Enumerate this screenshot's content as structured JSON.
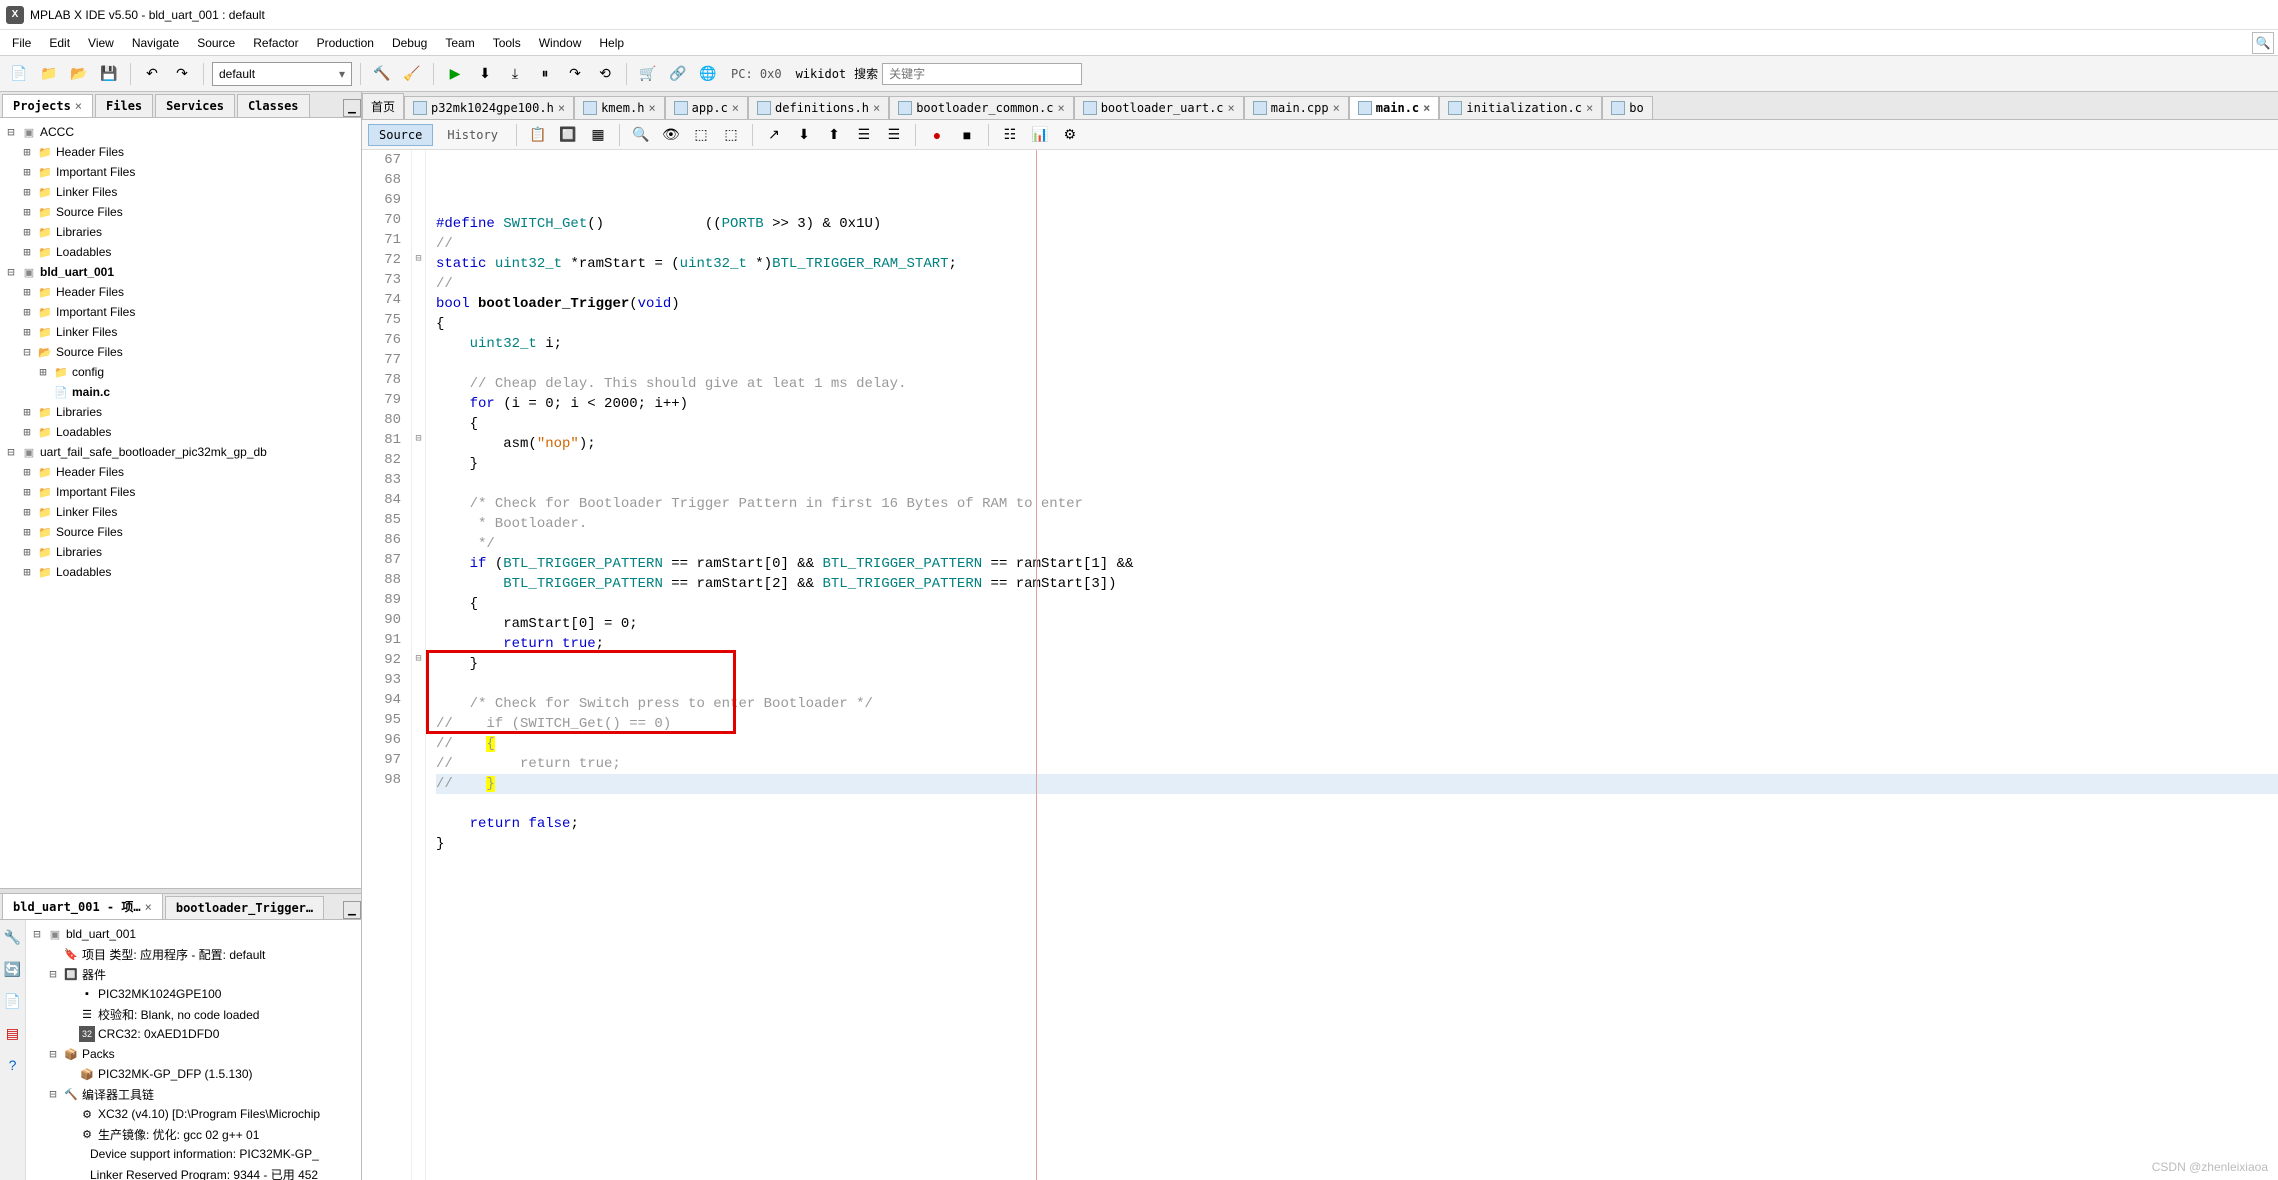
{
  "title": "MPLAB X IDE v5.50 - bld_uart_001 : default",
  "menubar": [
    "File",
    "Edit",
    "View",
    "Navigate",
    "Source",
    "Refactor",
    "Production",
    "Debug",
    "Team",
    "Tools",
    "Window",
    "Help"
  ],
  "toolbar": {
    "config_combo": "default",
    "pc_label": "PC: 0x0",
    "wikidot": "wikidot",
    "search_label": "搜索",
    "search_placeholder": "关键字"
  },
  "left_tabs": {
    "projects": "Projects",
    "files": "Files",
    "services": "Services",
    "classes": "Classes"
  },
  "projects": [
    {
      "name": "ACCC",
      "bold": false,
      "children": [
        "Header Files",
        "Important Files",
        "Linker Files",
        "Source Files",
        "Libraries",
        "Loadables"
      ]
    },
    {
      "name": "bld_uart_001",
      "bold": true,
      "children": [
        "Header Files",
        "Important Files",
        "Linker Files"
      ],
      "source_files": {
        "label": "Source Files",
        "children": [
          {
            "name": "config",
            "type": "folder"
          },
          {
            "name": "main.c",
            "type": "file",
            "selected": true
          }
        ]
      },
      "tail": [
        "Libraries",
        "Loadables"
      ]
    },
    {
      "name": "uart_fail_safe_bootloader_pic32mk_gp_db",
      "bold": false,
      "children": [
        "Header Files",
        "Important Files",
        "Linker Files",
        "Source Files",
        "Libraries",
        "Loadables"
      ]
    }
  ],
  "lower_tabs": {
    "dashboard": "bld_uart_001 - 项…",
    "nav": "bootloader_Trigger…"
  },
  "dashboard": {
    "proj": "bld_uart_001",
    "proj_type": "项目 类型: 应用程序 - 配置: default",
    "device_hdr": "器件",
    "device": "PIC32MK1024GPE100",
    "checksum": "校验和: Blank, no code loaded",
    "crc32": "CRC32: 0xAED1DFD0",
    "packs_hdr": "Packs",
    "pack": "PIC32MK-GP_DFP (1.5.130)",
    "toolchain_hdr": "编译器工具链",
    "xc32": "XC32 (v4.10) [D:\\Program Files\\Microchip",
    "prod_image": "生产镜像: 优化: gcc 02 g++ 01",
    "dev_support": "Device support information: PIC32MK-GP_",
    "linker_res": "Linker Reserved Program: 9344 - 已用 452"
  },
  "editor_tabs": [
    {
      "label": "首页",
      "icon": false,
      "closable": false
    },
    {
      "label": "p32mk1024gpe100.h",
      "icon": true,
      "closable": true
    },
    {
      "label": "kmem.h",
      "icon": true,
      "closable": true
    },
    {
      "label": "app.c",
      "icon": true,
      "closable": true
    },
    {
      "label": "definitions.h",
      "icon": true,
      "closable": true
    },
    {
      "label": "bootloader_common.c",
      "icon": true,
      "closable": true
    },
    {
      "label": "bootloader_uart.c",
      "icon": true,
      "closable": true
    },
    {
      "label": "main.cpp",
      "icon": true,
      "closable": true
    },
    {
      "label": "main.c",
      "icon": true,
      "closable": true,
      "active": true
    },
    {
      "label": "initialization.c",
      "icon": true,
      "closable": true
    },
    {
      "label": "bo",
      "icon": true,
      "closable": false
    }
  ],
  "editor_toolbar": {
    "source": "Source",
    "history": "History"
  },
  "code": {
    "first_line": 67,
    "lines": [
      {
        "n": 67,
        "html": "<span class='pp'>#define</span> <span class='mac'>SWITCH_Get</span>()            ((<span class='mac'>PORTB</span> &gt;&gt; 3) &amp; 0x1U)"
      },
      {
        "n": 68,
        "html": "<span class='com'>//</span>"
      },
      {
        "n": 69,
        "html": "<span class='kw'>static</span> <span class='mac'>uint32_t</span> *ramStart = (<span class='mac'>uint32_t</span> *)<span class='mac'>BTL_TRIGGER_RAM_START</span>;"
      },
      {
        "n": 70,
        "html": "<span class='com'>//</span>"
      },
      {
        "n": 71,
        "html": "<span class='kw'>bool</span> <span class='fn'>bootloader_Trigger</span>(<span class='kw'>void</span>)"
      },
      {
        "n": 72,
        "html": "{",
        "fold": "start"
      },
      {
        "n": 73,
        "html": "    <span class='mac'>uint32_t</span> i;"
      },
      {
        "n": 74,
        "html": ""
      },
      {
        "n": 75,
        "html": "    <span class='com'>// Cheap delay. This should give at leat 1 ms delay.</span>"
      },
      {
        "n": 76,
        "html": "    <span class='kw'>for</span> (i = 0; i &lt; 2000; i++)"
      },
      {
        "n": 77,
        "html": "    {"
      },
      {
        "n": 78,
        "html": "        asm(<span class='str'>\"nop\"</span>);"
      },
      {
        "n": 79,
        "html": "    }"
      },
      {
        "n": 80,
        "html": ""
      },
      {
        "n": 81,
        "html": "    <span class='com'>/* Check for Bootloader Trigger Pattern in first 16 Bytes of RAM to enter</span>",
        "fold": "start"
      },
      {
        "n": 82,
        "html": "<span class='com'>     * Bootloader.</span>"
      },
      {
        "n": 83,
        "html": "<span class='com'>     */</span>"
      },
      {
        "n": 84,
        "html": "    <span class='kw'>if</span> (<span class='mac'>BTL_TRIGGER_PATTERN</span> == ramStart[0] &amp;&amp; <span class='mac'>BTL_TRIGGER_PATTERN</span> == ramStart[1] &amp;&amp;"
      },
      {
        "n": 85,
        "html": "        <span class='mac'>BTL_TRIGGER_PATTERN</span> == ramStart[2] &amp;&amp; <span class='mac'>BTL_TRIGGER_PATTERN</span> == ramStart[3])"
      },
      {
        "n": 86,
        "html": "    {"
      },
      {
        "n": 87,
        "html": "        ramStart[0] = 0;"
      },
      {
        "n": 88,
        "html": "        <span class='kw'>return</span> <span class='kw'>true</span>;"
      },
      {
        "n": 89,
        "html": "    }"
      },
      {
        "n": 90,
        "html": ""
      },
      {
        "n": 91,
        "html": "    <span class='com'>/* Check for Switch press to enter Bootloader */</span>"
      },
      {
        "n": 92,
        "html": "<span class='com'>//    if (SWITCH_Get() == 0)</span>",
        "fold": "start"
      },
      {
        "n": 93,
        "html": "<span class='com'>//    </span><span class='hl-y com'>{</span>"
      },
      {
        "n": 94,
        "html": "<span class='com'>//        return true;</span>"
      },
      {
        "n": 95,
        "html": "<span class='com'>//    </span><span class='hl-y com'>}</span>",
        "current": true
      },
      {
        "n": 96,
        "html": ""
      },
      {
        "n": 97,
        "html": "    <span class='kw'>return</span> <span class='kw'>false</span>;"
      },
      {
        "n": 98,
        "html": "}"
      }
    ]
  },
  "watermark": "CSDN @zhenleixiaoa"
}
